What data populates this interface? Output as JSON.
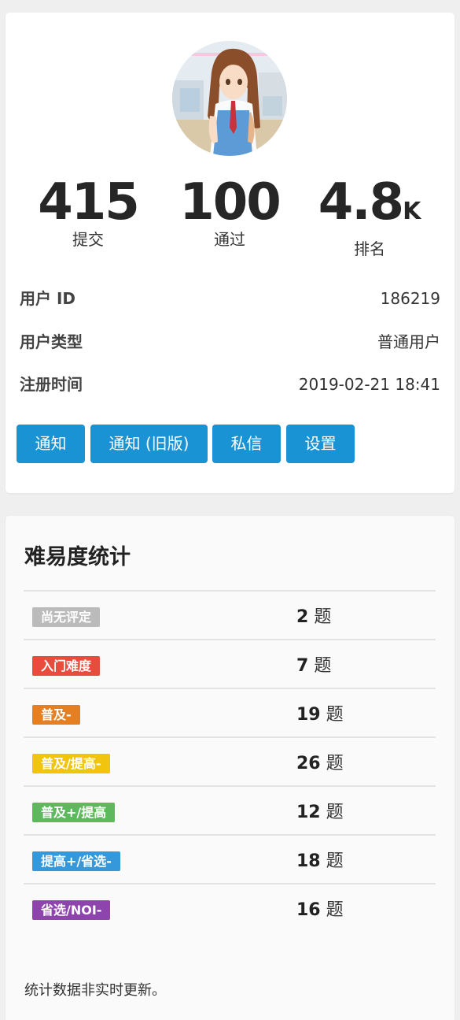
{
  "stats": [
    {
      "value": "415",
      "unit": "",
      "label": "提交"
    },
    {
      "value": "100",
      "unit": "",
      "label": "通过"
    },
    {
      "value": "4.8",
      "unit": "K",
      "label": "排名"
    }
  ],
  "info": [
    {
      "key": "用户 ID",
      "value": "186219"
    },
    {
      "key": "用户类型",
      "value": "普通用户"
    },
    {
      "key": "注册时间",
      "value": "2019-02-21 18:41"
    }
  ],
  "buttons": [
    "通知",
    "通知 (旧版)",
    "私信",
    "设置"
  ],
  "difficulty": {
    "title": "难易度统计",
    "unit_label": "题",
    "rows": [
      {
        "label": "尚无评定",
        "count": "2",
        "color": "#bbbbbb"
      },
      {
        "label": "入门难度",
        "count": "7",
        "color": "#e74c3c"
      },
      {
        "label": "普及-",
        "count": "19",
        "color": "#e67e22"
      },
      {
        "label": "普及/提高-",
        "count": "26",
        "color": "#f1c40f"
      },
      {
        "label": "普及+/提高",
        "count": "12",
        "color": "#5eb95e"
      },
      {
        "label": "提高+/省选-",
        "count": "18",
        "color": "#3498db"
      },
      {
        "label": "省选/NOI-",
        "count": "16",
        "color": "#8e44ad"
      }
    ],
    "note": "统计数据非实时更新。"
  }
}
